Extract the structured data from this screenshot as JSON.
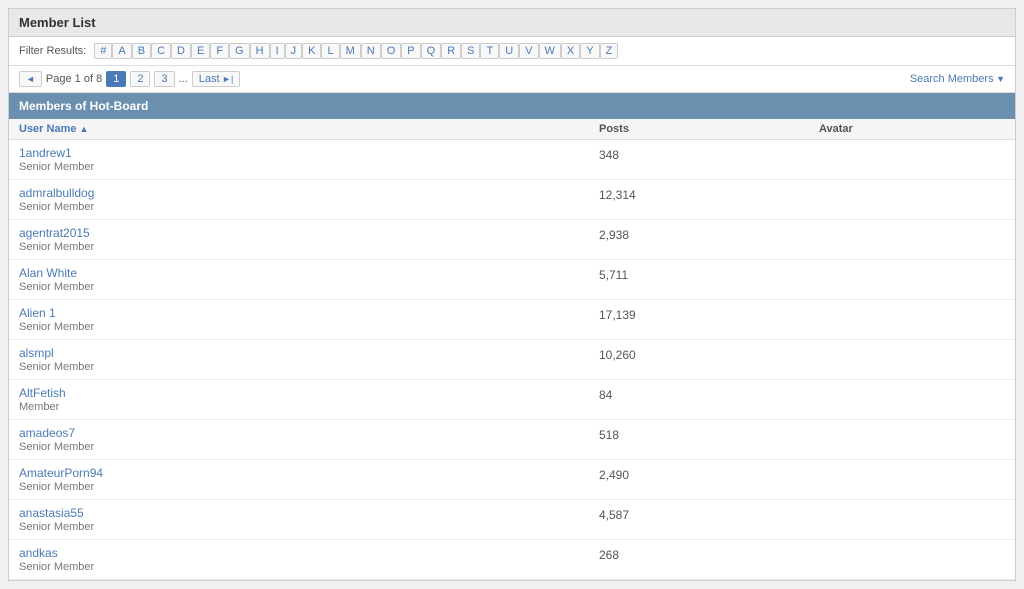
{
  "page": {
    "title": "Member List",
    "filter_label": "Filter Results:",
    "letters": [
      "#",
      "A",
      "B",
      "C",
      "D",
      "E",
      "F",
      "G",
      "H",
      "I",
      "J",
      "K",
      "L",
      "M",
      "N",
      "O",
      "P",
      "Q",
      "R",
      "S",
      "T",
      "U",
      "V",
      "W",
      "X",
      "Y",
      "Z"
    ],
    "pagination": {
      "prev_label": "Page 1 of 8",
      "page1": "1",
      "page2": "2",
      "page3": "3",
      "ellipsis": "...",
      "last_label": "Last",
      "search_label": "Search Members"
    },
    "section_title": "Members of Hot-Board",
    "table_headers": {
      "username": "User Name",
      "posts": "Posts",
      "avatar": "Avatar"
    },
    "members": [
      {
        "name": "1andrew1",
        "role": "Senior Member",
        "posts": "348"
      },
      {
        "name": "admralbulldog",
        "role": "Senior Member",
        "posts": "12,314"
      },
      {
        "name": "agentrat2015",
        "role": "Senior Member",
        "posts": "2,938"
      },
      {
        "name": "Alan White",
        "role": "Senior Member",
        "posts": "5,711"
      },
      {
        "name": "Alien 1",
        "role": "Senior Member",
        "posts": "17,139"
      },
      {
        "name": "alsmpl",
        "role": "Senior Member",
        "posts": "10,260"
      },
      {
        "name": "AltFetish",
        "role": "Member",
        "posts": "84"
      },
      {
        "name": "amadeos7",
        "role": "Senior Member",
        "posts": "518"
      },
      {
        "name": "AmateurPorn94",
        "role": "Senior Member",
        "posts": "2,490"
      },
      {
        "name": "anastasia55",
        "role": "Senior Member",
        "posts": "4,587"
      },
      {
        "name": "andkas",
        "role": "Senior Member",
        "posts": "268"
      }
    ]
  }
}
